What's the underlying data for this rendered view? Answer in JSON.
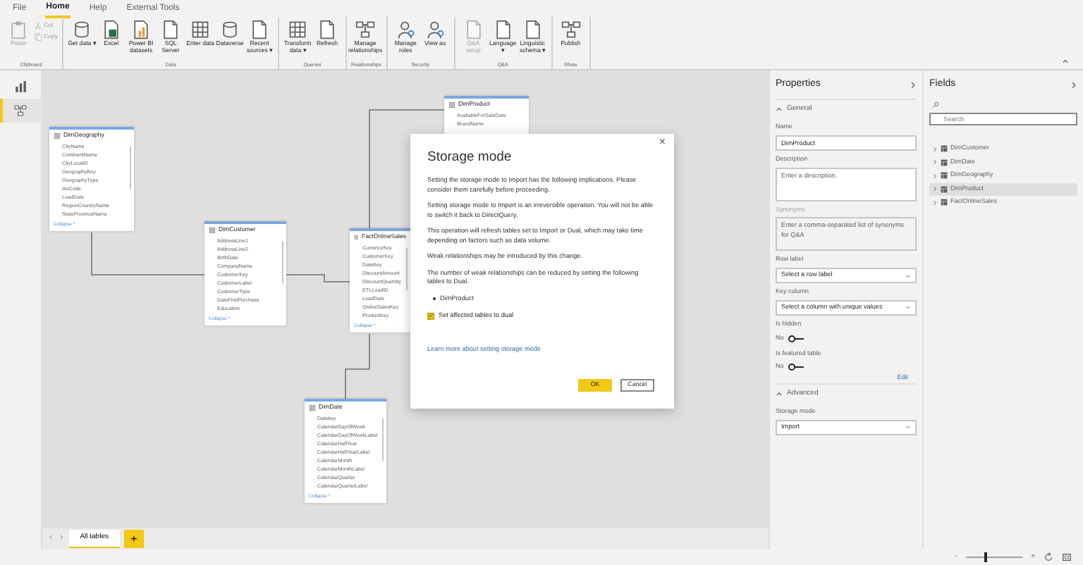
{
  "menu": [
    {
      "label": "File",
      "selected": false
    },
    {
      "label": "Home",
      "selected": true
    },
    {
      "label": "Help",
      "selected": false
    },
    {
      "label": "External Tools",
      "selected": false
    }
  ],
  "ribbon": [
    {
      "label": "Clipboard",
      "buttons": [
        {
          "label": "Paste",
          "kind": "large",
          "disabled": true
        },
        {
          "label": "Cut",
          "kind": "small",
          "disabled": true
        },
        {
          "label": "Copy",
          "kind": "small",
          "disabled": true
        }
      ]
    },
    {
      "label": "Data",
      "buttons": [
        {
          "label": "Get data ▾",
          "kind": "large",
          "disabled": false
        },
        {
          "label": "Excel",
          "kind": "large",
          "disabled": false
        },
        {
          "label": "Power BI datasets",
          "kind": "large",
          "disabled": false
        },
        {
          "label": "SQL Server",
          "kind": "large",
          "disabled": false
        },
        {
          "label": "Enter data",
          "kind": "large",
          "disabled": false
        },
        {
          "label": "Dataverse",
          "kind": "large",
          "disabled": false
        },
        {
          "label": "Recent sources ▾",
          "kind": "large",
          "disabled": false
        }
      ]
    },
    {
      "label": "Queries",
      "buttons": [
        {
          "label": "Transform data ▾",
          "kind": "large",
          "disabled": false
        },
        {
          "label": "Refresh",
          "kind": "large",
          "disabled": false
        }
      ]
    },
    {
      "label": "Relationships",
      "buttons": [
        {
          "label": "Manage relationships",
          "kind": "large",
          "disabled": false
        }
      ]
    },
    {
      "label": "Security",
      "buttons": [
        {
          "label": "Manage roles",
          "kind": "large",
          "disabled": false
        },
        {
          "label": "View as",
          "kind": "large",
          "disabled": false
        }
      ]
    },
    {
      "label": "Q&A",
      "buttons": [
        {
          "label": "Q&A setup",
          "kind": "large",
          "disabled": true
        },
        {
          "label": "Language ▾",
          "kind": "large",
          "disabled": false
        },
        {
          "label": "Linguistic schema ▾",
          "kind": "large",
          "disabled": false
        }
      ]
    },
    {
      "label": "Share",
      "buttons": [
        {
          "label": "Publish",
          "kind": "large",
          "disabled": false
        }
      ]
    }
  ],
  "view_rail": [
    {
      "selected": false
    },
    {
      "selected": true
    }
  ],
  "tables": [
    {
      "title": "DimGeography",
      "columns": [
        "CityName",
        "ContinentName",
        "CityLocalID",
        "GeographyKey",
        "GeographyType",
        "IsoCode",
        "LoadDate",
        "RegionCountryName",
        "StateProvinceName"
      ],
      "footer": "Collapse ^"
    },
    {
      "title": "DimCustomer",
      "columns": [
        "AddressLine1",
        "AddressLine2",
        "BirthDate",
        "CompanyName",
        "CustomerKey",
        "CustomerLabel",
        "CustomerType",
        "DateFirstPurchase",
        "Education"
      ],
      "footer": "Collapse ^"
    },
    {
      "title": "FactOnlineSales",
      "columns": [
        "CurrencyKey",
        "CustomerKey",
        "DateKey",
        "DiscountAmount",
        "DiscountQuantity",
        "ETLLoadID",
        "LoadDate",
        "OnlineSalesKey",
        "ProductKey"
      ],
      "footer": "Collapse ^"
    },
    {
      "title": "DimDate",
      "columns": [
        "Datekey",
        "CalendarDayOfWeek",
        "CalendarDayOfWeekLabel",
        "CalendarHalfYear",
        "CalendarHalfYearLabel",
        "CalendarMonth",
        "CalendarMonthLabel",
        "CalendarQuarter",
        "CalendarQuarterLabel"
      ],
      "footer": "Collapse ^"
    },
    {
      "title": "DimProduct",
      "columns": [
        "AvailableForSaleDate",
        "BrandName"
      ]
    }
  ],
  "dialog": {
    "title": "Storage mode",
    "close": "×",
    "paragraphs": [
      "Setting the storage mode to Import has the following implications. Please consider them carefully before proceeding.",
      "Setting storage mode to Import is an irreversible operation. You will not be able to switch it back to DirectQuery.",
      "This operation will refresh tables set to Import or Dual, which may take time depending on factors such as data volume.",
      "Weak relationships may be introduced by this change.",
      "The number of weak relationships can be reduced by setting the following tables to Dual."
    ],
    "list": [
      "DimProduct"
    ],
    "checkbox": {
      "label": "Set affected tables to dual",
      "checked": true
    },
    "link": "Learn more about setting storage mode",
    "buttons": [
      {
        "label": "OK",
        "kind": "primary"
      },
      {
        "label": "Cancel",
        "kind": "secondary"
      }
    ]
  },
  "page_tabs": {
    "nav": [
      "‹",
      "›"
    ],
    "tabs": [
      {
        "label": "All tables",
        "selected": true
      }
    ],
    "add": "+"
  },
  "properties": {
    "title": "Properties",
    "sections": [
      {
        "title": "General",
        "expanded": true,
        "items": [
          {
            "kind": "input",
            "label": "Name",
            "value": "DimProduct"
          },
          {
            "kind": "textarea",
            "label": "Description",
            "placeholder": "Enter a description.",
            "disabled": false
          },
          {
            "kind": "textarea",
            "label": "Synonyms",
            "placeholder": "Enter a comma-separated list of synonyms for Q&A",
            "disabled": true
          },
          {
            "kind": "select",
            "label": "Row label",
            "value": "Select a row label"
          },
          {
            "kind": "select",
            "label": "Key column",
            "value": "Select a column with unique values"
          },
          {
            "kind": "toggle",
            "label": "Is hidden",
            "value": "No",
            "on": false
          },
          {
            "kind": "toggle",
            "label": "Is featured table",
            "value": "No",
            "on": false
          },
          {
            "kind": "link",
            "label": "Edit"
          }
        ]
      },
      {
        "title": "Advanced",
        "expanded": true,
        "items": [
          {
            "kind": "select",
            "label": "Storage mode",
            "value": "Import"
          }
        ]
      }
    ]
  },
  "fields": {
    "title": "Fields",
    "search": {
      "placeholder": "Search"
    },
    "tables": [
      {
        "name": "DimCustomer",
        "selected": false
      },
      {
        "name": "DimDate",
        "selected": false
      },
      {
        "name": "DimGeography",
        "selected": false
      },
      {
        "name": "DimProduct",
        "selected": true
      },
      {
        "name": "FactOnlineSales",
        "selected": false
      }
    ]
  },
  "status_bar": {
    "zoom": {
      "minus": "-",
      "plus": "+",
      "level": 0.35
    }
  }
}
